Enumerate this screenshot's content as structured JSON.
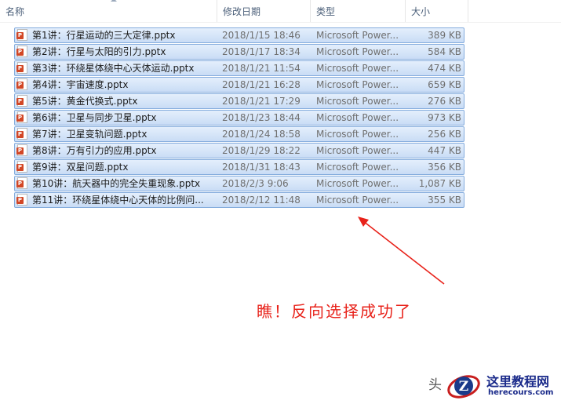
{
  "columns": {
    "name": "名称",
    "date": "修改日期",
    "type": "类型",
    "size": "大小"
  },
  "files": [
    {
      "name": "第1讲：行星运动的三大定律.pptx",
      "date": "2018/1/15 18:46",
      "type": "Microsoft Power...",
      "size": "389 KB"
    },
    {
      "name": "第2讲：行星与太阳的引力.pptx",
      "date": "2018/1/17 18:34",
      "type": "Microsoft Power...",
      "size": "584 KB"
    },
    {
      "name": "第3讲：环绕星体绕中心天体运动.pptx",
      "date": "2018/1/21 11:54",
      "type": "Microsoft Power...",
      "size": "474 KB"
    },
    {
      "name": "第4讲：宇宙速度.pptx",
      "date": "2018/1/21 16:28",
      "type": "Microsoft Power...",
      "size": "659 KB"
    },
    {
      "name": "第5讲：黄金代换式.pptx",
      "date": "2018/1/21 17:29",
      "type": "Microsoft Power...",
      "size": "276 KB"
    },
    {
      "name": "第6讲：卫星与同步卫星.pptx",
      "date": "2018/1/23 18:44",
      "type": "Microsoft Power...",
      "size": "973 KB"
    },
    {
      "name": "第7讲：卫星变轨问题.pptx",
      "date": "2018/1/24 18:58",
      "type": "Microsoft Power...",
      "size": "256 KB"
    },
    {
      "name": "第8讲：万有引力的应用.pptx",
      "date": "2018/1/29 18:22",
      "type": "Microsoft Power...",
      "size": "447 KB"
    },
    {
      "name": "第9讲：双星问题.pptx",
      "date": "2018/1/31 18:43",
      "type": "Microsoft Power...",
      "size": "356 KB"
    },
    {
      "name": "第10讲：航天器中的完全失重现象.pptx",
      "date": "2018/2/3 9:06",
      "type": "Microsoft Power...",
      "size": "1,087 KB"
    },
    {
      "name": "第11讲：环绕星体绕中心天体的比例问...",
      "date": "2018/2/12 11:48",
      "type": "Microsoft Power...",
      "size": "355 KB"
    }
  ],
  "file_icon": {
    "name": "pptx-file-icon",
    "badge": "P",
    "color": "#d24726"
  },
  "selection_color": "#c9dcf5",
  "annotation": {
    "text": "瞧！反向选择成功了",
    "color": "#e8221a",
    "arrow_icon": "red-arrow-icon"
  },
  "watermark": {
    "prefix": "头",
    "title": "这里教程网",
    "url": "herecours.com",
    "logo_icon": "z-globe-logo-icon"
  }
}
